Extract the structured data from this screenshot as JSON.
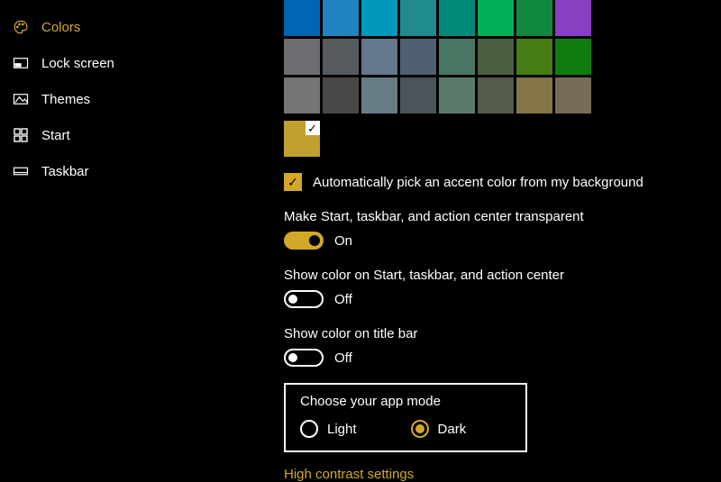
{
  "sidebar": {
    "items": [
      {
        "label": "Colors"
      },
      {
        "label": "Lock screen"
      },
      {
        "label": "Themes"
      },
      {
        "label": "Start"
      },
      {
        "label": "Taskbar"
      }
    ]
  },
  "palette": {
    "row1": [
      "#0264b4",
      "#1f82c1",
      "#0099bc",
      "#1f8b8f",
      "#008a79",
      "#00ae58",
      "#10893e",
      "#8840c0"
    ],
    "row2": [
      "#6b6d71",
      "#555a5f",
      "#65788d",
      "#4f6072",
      "#497865",
      "#4c5f42",
      "#457c15",
      "#107c10"
    ],
    "row3": [
      "#757575",
      "#4a4846",
      "#677b84",
      "#4a5459",
      "#5b7a6a",
      "#535c49",
      "#847545",
      "#766b59"
    ],
    "selected": "#c0a12f"
  },
  "accent": {
    "auto_label": "Automatically pick an accent color from my background",
    "checked": true
  },
  "transparency": {
    "label": "Make Start, taskbar, and action center transparent",
    "state": "On",
    "on": true
  },
  "show_color_start": {
    "label": "Show color on Start, taskbar, and action center",
    "state": "Off",
    "on": false
  },
  "show_color_title": {
    "label": "Show color on title bar",
    "state": "Off",
    "on": false
  },
  "app_mode": {
    "heading": "Choose your app mode",
    "options": {
      "light": "Light",
      "dark": "Dark"
    },
    "selected": "dark"
  },
  "high_contrast_link": "High contrast settings"
}
